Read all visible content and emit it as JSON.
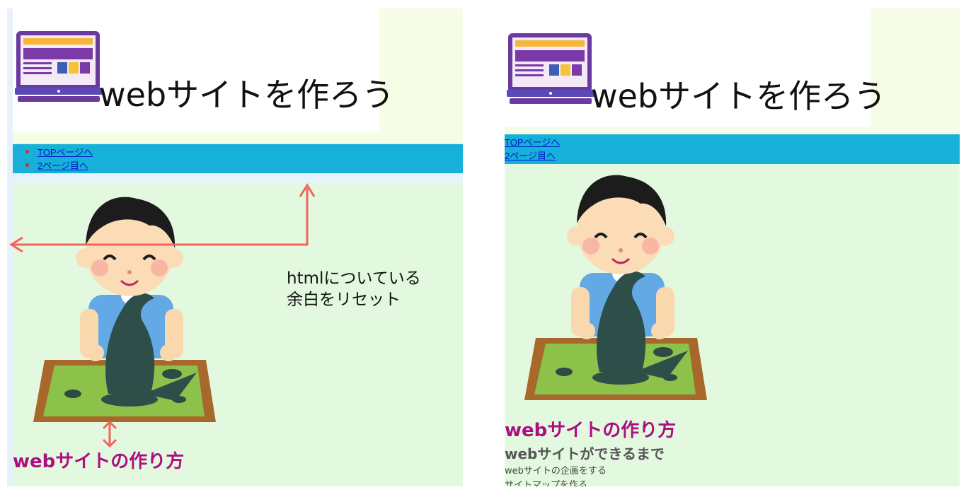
{
  "left_view": {
    "logo_text": "webサイトを作ろう",
    "nav_items": [
      "TOPページへ",
      "2ページ目へ"
    ],
    "annotation_lines": [
      "htmlについている",
      "余白をリセット"
    ],
    "heading": "webサイトの作り方"
  },
  "right_view": {
    "logo_text": "webサイトを作ろう",
    "nav_items": [
      "TOPページへ",
      "2ページ目へ"
    ],
    "heading": "webサイトの作り方",
    "subheading": "webサイトができるまで",
    "steps": [
      "webサイトの企画をする",
      "サイトマップを作る"
    ]
  },
  "colors": {
    "nav_bg": "#17b0d8",
    "heading": "#ac0f7f",
    "page_bg": "#e3f9df",
    "annotation_arrow": "#f2655c"
  }
}
